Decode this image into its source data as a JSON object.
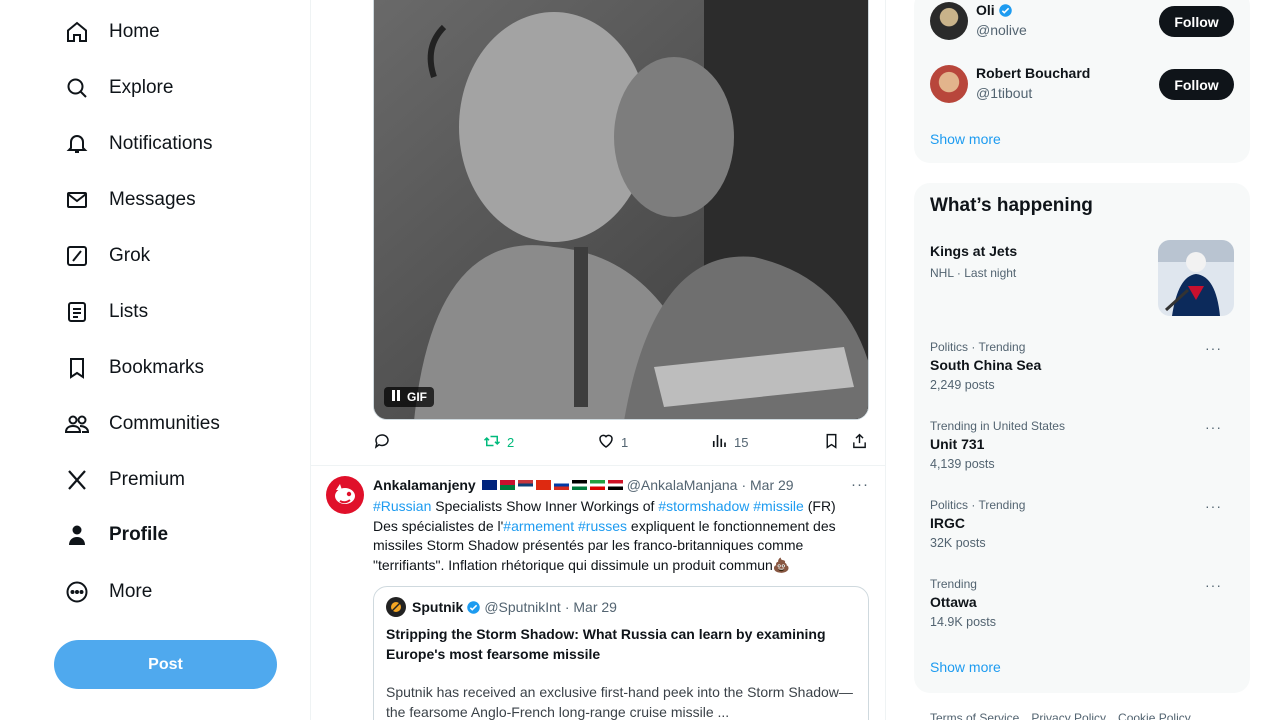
{
  "nav": {
    "items": [
      {
        "label": "Home",
        "icon": "home-icon"
      },
      {
        "label": "Explore",
        "icon": "search-icon"
      },
      {
        "label": "Notifications",
        "icon": "bell-icon"
      },
      {
        "label": "Messages",
        "icon": "mail-icon"
      },
      {
        "label": "Grok",
        "icon": "grok-icon"
      },
      {
        "label": "Lists",
        "icon": "list-icon"
      },
      {
        "label": "Bookmarks",
        "icon": "bookmark-icon"
      },
      {
        "label": "Communities",
        "icon": "people-icon"
      },
      {
        "label": "Premium",
        "icon": "x-logo-icon"
      },
      {
        "label": "Profile",
        "icon": "person-icon"
      },
      {
        "label": "More",
        "icon": "more-circle-icon"
      }
    ],
    "post_label": "Post"
  },
  "gif_post": {
    "badge": "GIF",
    "actions": {
      "replies": "",
      "reposts": "2",
      "likes": "1",
      "views": "15"
    }
  },
  "tweet": {
    "name": "Ankalamanjeny",
    "handle": "@AnkalaManjana",
    "date": "· Mar 29",
    "more": "···",
    "body": {
      "line1_ht1": "#Russian",
      "line1_t1": " Specialists Show Inner Workings of ",
      "line1_ht2": "#stormshadow",
      "line1_sp": " ",
      "line1_ht3": "#missile",
      "line1_t2": " (FR)",
      "line2_t1": "Des spécialistes de l'",
      "line2_ht1": "#armement",
      "line2_sp": " ",
      "line2_ht2": "#russes",
      "line2_t2": " expliquent le fonctionnement des missiles Storm Shadow présentés par les franco-britanniques comme \"terrifiants\". Inflation rhétorique qui dissimule un produit commun💩"
    },
    "quote": {
      "name": "Sputnik",
      "handle": "@SputnikInt",
      "date": "· Mar 29",
      "title": "Stripping the Storm Shadow: What Russia can learn by examining Europe's most fearsome missile",
      "text": "Sputnik has received an exclusive first-hand peek into the Storm Shadow—the fearsome Anglo-French long-range cruise missile ..."
    }
  },
  "who_to_follow": {
    "users": [
      {
        "name": "Oli",
        "handle": "@nolive",
        "button": "Follow"
      },
      {
        "name": "Robert Bouchard",
        "handle": "@1tibout",
        "button": "Follow"
      }
    ],
    "show_more": "Show more"
  },
  "happening": {
    "title": "What’s happening",
    "featured": {
      "title": "Kings at Jets",
      "context": "NHL · Last night"
    },
    "trends": [
      {
        "context": "Politics · Trending",
        "title": "South China Sea",
        "count": "2,249 posts"
      },
      {
        "context": "Trending in United States",
        "title": "Unit 731",
        "count": "4,139 posts"
      },
      {
        "context": "Politics · Trending",
        "title": "IRGC",
        "count": "32K posts"
      },
      {
        "context": "Trending",
        "title": "Ottawa",
        "count": "14.9K posts"
      }
    ],
    "show_more": "Show more"
  },
  "footer": {
    "links": [
      "Terms of Service",
      "Privacy Policy",
      "Cookie Policy"
    ]
  },
  "colors": {
    "accent": "#1d9bf0",
    "post_button": "#4fa9ee",
    "repost_green": "#00ba7c",
    "text": "#0f1419",
    "muted": "#536471"
  }
}
